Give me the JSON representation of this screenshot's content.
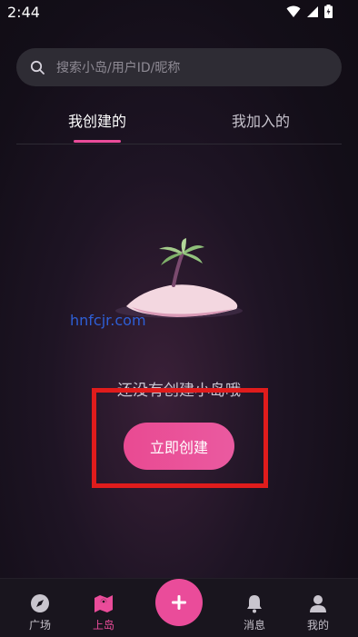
{
  "status_bar": {
    "time": "2:44"
  },
  "search": {
    "placeholder": "搜索小岛/用户ID/昵称"
  },
  "tabs": [
    {
      "label": "我创建的",
      "active": true
    },
    {
      "label": "我加入的",
      "active": false
    }
  ],
  "watermark": "hnfcjr.com",
  "empty_state": {
    "message": "还没有创建小岛哦",
    "button_label": "立即创建"
  },
  "bottom_nav": [
    {
      "label": "广场",
      "icon": "compass-icon",
      "active": false
    },
    {
      "label": "上岛",
      "icon": "map-icon",
      "active": true
    },
    {
      "label": "",
      "icon": "plus-icon",
      "active": false
    },
    {
      "label": "消息",
      "icon": "bell-icon",
      "active": false
    },
    {
      "label": "我的",
      "icon": "user-icon",
      "active": false
    }
  ],
  "colors": {
    "accent": "#ea4c9a",
    "background": "#130e18",
    "search_bg": "#2e2c34",
    "highlight": "#e01c1c"
  }
}
